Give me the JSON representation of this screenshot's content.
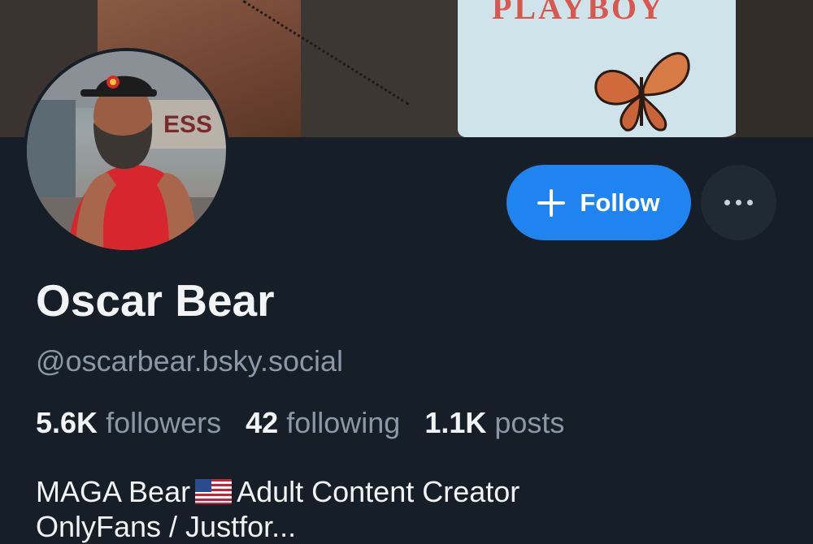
{
  "banner": {
    "shirt_text": "PLAYBOY"
  },
  "profile": {
    "display_name": "Oscar Bear",
    "handle": "@oscarbear.bsky.social",
    "avatar_icon": "avatar-photo"
  },
  "actions": {
    "follow_label": "Follow",
    "follow_icon": "plus-icon",
    "more_icon": "ellipsis-icon"
  },
  "stats": [
    {
      "value": "5.6K",
      "label": "followers"
    },
    {
      "value": "42",
      "label": "following"
    },
    {
      "value": "1.1K",
      "label": "posts"
    }
  ],
  "bio": {
    "line1_before": "MAGA Bear",
    "flag_icon": "us-flag-icon",
    "line1_after": "Adult Content Creator",
    "line2": "OnlyFans / Justfor..."
  },
  "colors": {
    "background": "#161e27",
    "accent": "#1f83f0",
    "muted_text": "#8b98a7"
  }
}
